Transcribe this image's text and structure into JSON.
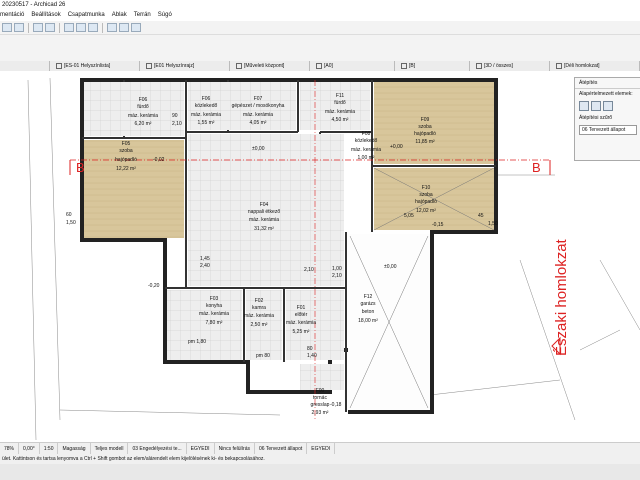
{
  "window": {
    "title": "20230517 - Archicad 26"
  },
  "menu": [
    "mentáció",
    "Beállítások",
    "Csapatmunka",
    "Ablak",
    "Terrán",
    "Súgó"
  ],
  "tabs": [
    "[ES-01 Helyszínlista]",
    "[E01 Helyszínrajz]",
    "[Műveleti központ]",
    "[A0]",
    "[B]",
    "[3D / összes]",
    "[Déli homlokzat]"
  ],
  "panel": {
    "title": "Átépítés",
    "filter_label": "Alapértelmezett elemek:",
    "view_label": "Átépítési szűrő",
    "view_value": "06 Tervezett állapot"
  },
  "status": {
    "zoom": "78%",
    "angle": "0,00°",
    "scale": "1:50",
    "view1": "Magasság",
    "view2": "Teljes modell",
    "layer": "03 Engedélyezési te...",
    "custom": "EGYEDI",
    "filter": "Nincs felülírás",
    "state": "06 Tervezett állapot",
    "custom2": "EGYEDI"
  },
  "hint": "ület. Kattintson és tartsa lenyomva a Ctrl + Shift gombot az elem/alárendelt elem kijelölésének ki- és bekapcsolásához.",
  "section": {
    "left": "B",
    "right": "B"
  },
  "facade_label": "Északi homlokzat",
  "rooms": [
    {
      "id": "F06",
      "name": "fürdő",
      "finish": "máz. kerámia",
      "area": "6,20 m²"
    },
    {
      "id": "F06",
      "name": "közlekedő",
      "finish": "máz. kerámia",
      "area": "1,55 m²"
    },
    {
      "id": "F07",
      "name": "gépészet / mosókonyha",
      "finish": "máz. kerámia",
      "area": "4,05 m²"
    },
    {
      "id": "F11",
      "name": "fürdő",
      "finish": "máz. kerámia",
      "area": "4,50 m²"
    },
    {
      "id": "F09",
      "name": "szoba",
      "finish": "hajópadló",
      "area": "11,85 m²"
    },
    {
      "id": "F05",
      "name": "szoba",
      "finish": "hajópadló",
      "area": "12,22 m²"
    },
    {
      "id": "F08",
      "name": "közlekedő",
      "finish": "máz. kerámia",
      "area": "1,00 m²"
    },
    {
      "id": "F10",
      "name": "szoba",
      "finish": "hajópadló",
      "area": "12,02 m²"
    },
    {
      "id": "F04",
      "name": "nappali étkező",
      "finish": "máz. kerámia",
      "area": "31,32 m²"
    },
    {
      "id": "F03",
      "name": "konyha",
      "finish": "máz. kerámia",
      "area": "7,80 m²"
    },
    {
      "id": "F02",
      "name": "kamra",
      "finish": "máz. kerámia",
      "area": "2,50 m²"
    },
    {
      "id": "F01",
      "name": "előtér",
      "finish": "máz. kerámia",
      "area": "5,25 m²"
    },
    {
      "id": "F12",
      "name": "garázs",
      "finish": "beton",
      "area": "18,00 m²"
    },
    {
      "id": "F00",
      "name": "tornác",
      "finish": "gresslap",
      "area": "2,93 m²"
    }
  ],
  "levels": [
    "±0,00",
    "+0,00",
    "-0,02",
    "-0,20",
    "-0,18",
    "-0,15",
    "±0,00"
  ],
  "dims": [
    "90",
    "2,10",
    "60",
    "1,50",
    "1,45",
    "2,40",
    "2,10",
    "1,00",
    "2,10",
    "5,05",
    "45",
    "1,50",
    "pm 1,80",
    "pm 80",
    "80",
    "1,40"
  ]
}
